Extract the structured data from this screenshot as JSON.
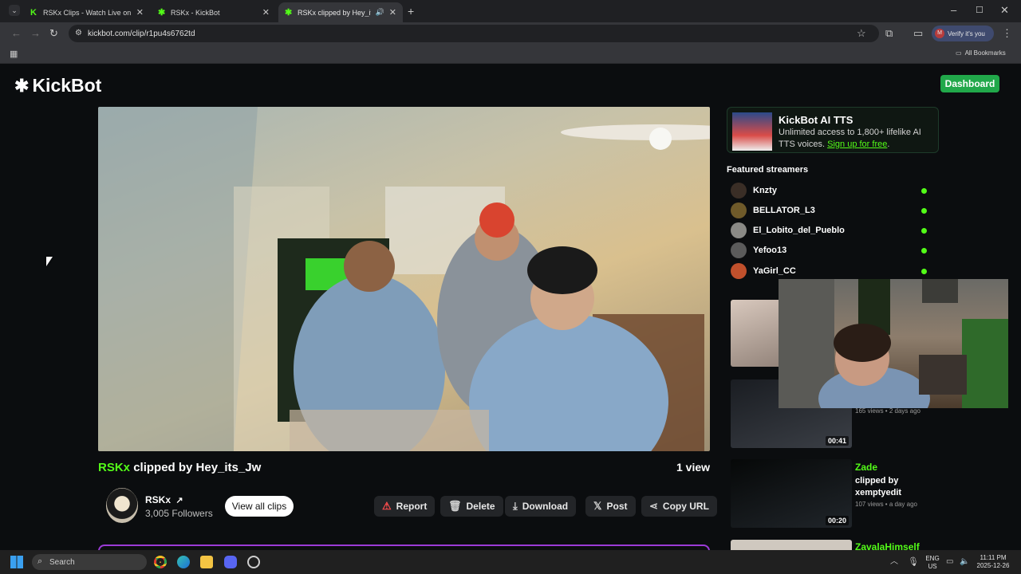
{
  "browser": {
    "tabs": [
      {
        "label": "RSKx Clips - Watch Live on Kick",
        "active": false
      },
      {
        "label": "RSKx - KickBot",
        "active": false
      },
      {
        "label": "RSKx clipped by Hey_its_Jw",
        "active": true
      }
    ],
    "url": "kickbot.com/clip/r1pu4s6762td",
    "profile_label": "Verify it's you",
    "profile_initial": "M",
    "bookmarks_label": "All Bookmarks"
  },
  "site": {
    "logo": "KickBot",
    "dashboard_label": "Dashboard"
  },
  "clip": {
    "channel": "RSKx",
    "clipped_by_text": "clipped by Hey_its_Jw",
    "views": "1 view",
    "channel_name": "RSKx",
    "followers": "3,005 Followers",
    "view_all_label": "View all clips",
    "actions": {
      "report": "Report",
      "delete": "Delete",
      "download": "Download",
      "post": "Post",
      "copy_url": "Copy URL"
    }
  },
  "tts_promo": {
    "title": "KickBot AI TTS",
    "description": "Unlimited access to 1,800+ lifelike AI TTS voices.",
    "link": "Sign up for free",
    "link_suffix": "."
  },
  "featured": {
    "heading": "Featured streamers",
    "streamers": [
      {
        "name": "Knzty"
      },
      {
        "name": "BELLATOR_L3"
      },
      {
        "name": "El_Lobito_del_Pueblo"
      },
      {
        "name": "Yefoo13"
      },
      {
        "name": "YaGirl_CC"
      }
    ]
  },
  "clips": [
    {
      "meta": "165 views • 2 days ago",
      "duration": "00:41"
    },
    {
      "channel": "Zade",
      "clipped_by": "clipped by xemptyedit",
      "meta": "107 views • a day ago",
      "duration": "00:20"
    },
    {
      "channel": "ZavalaHimself"
    }
  ],
  "taskbar": {
    "search_placeholder": "Search",
    "lang": "ENG",
    "region": "US",
    "time": "11:11 PM",
    "date": "2025-12-26"
  },
  "colors": {
    "kick_green": "#53fc18",
    "dashboard_green": "#21a84a",
    "page_bg": "#0b0d0f"
  }
}
